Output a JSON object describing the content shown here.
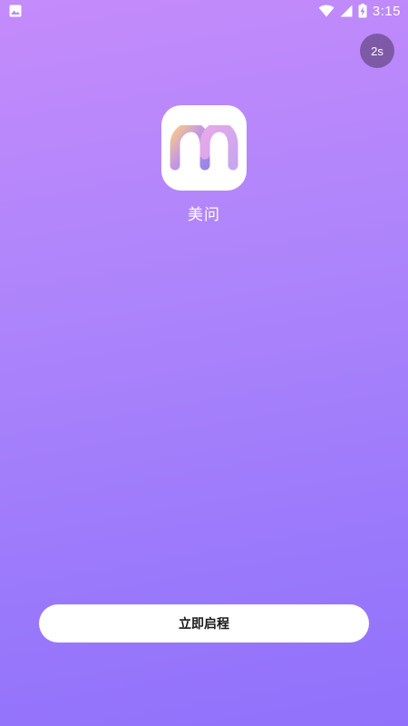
{
  "status_bar": {
    "time": "3:15",
    "icons": [
      "image-icon",
      "wifi-icon",
      "signal-icon",
      "battery-charging-icon"
    ]
  },
  "splash": {
    "skip_countdown": "2s",
    "app_name": "美问",
    "start_button_label": "立即启程"
  },
  "colors": {
    "background_top": "#c48bfb",
    "background_bottom": "#9171fb",
    "skip_badge": "#7e5aa6",
    "button_bg": "#ffffff"
  }
}
